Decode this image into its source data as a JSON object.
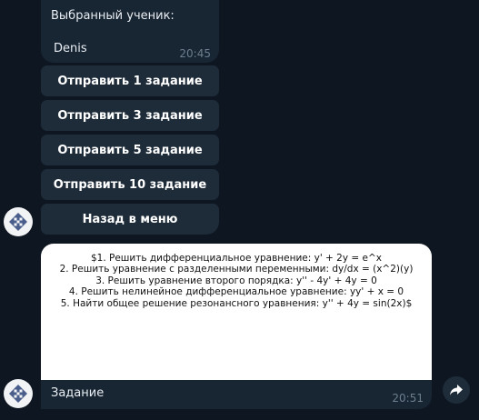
{
  "message_top": {
    "label": "Выбранный ученик:",
    "student": "Denis",
    "time": "20:45"
  },
  "keyboard": {
    "buttons": [
      "Отправить 1 задание",
      "Отправить 3 задание",
      "Отправить 5 задание",
      "Отправить 10 задание",
      "Назад в меню"
    ]
  },
  "photo_message": {
    "tasks": [
      "$1. Решить дифференциальное уравнение: y' + 2y = e^x",
      "2. Решить уравнение с разделенными переменными: dy/dx = (x^2)(y)",
      "3. Решить уравнение второго порядка: y'' - 4y' + 4y = 0",
      "4. Решить нелинейное дифференциальное уравнение: yy' + x = 0",
      "5. Найти общее решение резонансного уравнения: y'' + 4y = sin(2x)$"
    ],
    "caption": "Задание",
    "time": "20:51"
  },
  "icons": {
    "avatar": "bot-avatar-icon",
    "share": "share-icon"
  },
  "colors": {
    "background": "#0e1621",
    "bubble": "#182533",
    "button": "#1e2c3a",
    "timestamp": "#6d7f8f",
    "avatar_logo": "#4a5e8c"
  }
}
